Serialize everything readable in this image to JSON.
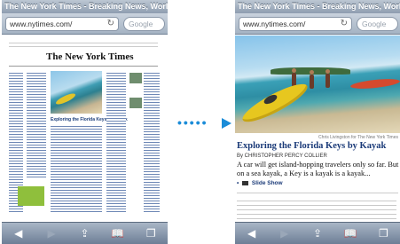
{
  "browser": {
    "page_title": "The New York Times - Breaking News, World...",
    "url": "www.nytimes.com/",
    "search_placeholder": "Google"
  },
  "left_page": {
    "logo": "The New York Times",
    "headline": "Exploring the Florida Keys by Kayak"
  },
  "article": {
    "photo_credit": "Chris Livingston for The New York Times",
    "headline": "Exploring the Florida Keys by Kayak",
    "byline": "By CHRISTOPHER PERCY COLLIER",
    "summary": "A car will get island-hopping travelers only so far. But on a sea kayak, a Key is a kayak is a kayak...",
    "slideshow_label": "Slide Show"
  },
  "colors": {
    "arrow": "#1b8cd8",
    "link": "#1a3a78"
  },
  "icons": [
    "back-arrow-icon",
    "forward-arrow-icon",
    "share-icon",
    "bookmarks-icon",
    "pages-icon",
    "reload-icon"
  ]
}
